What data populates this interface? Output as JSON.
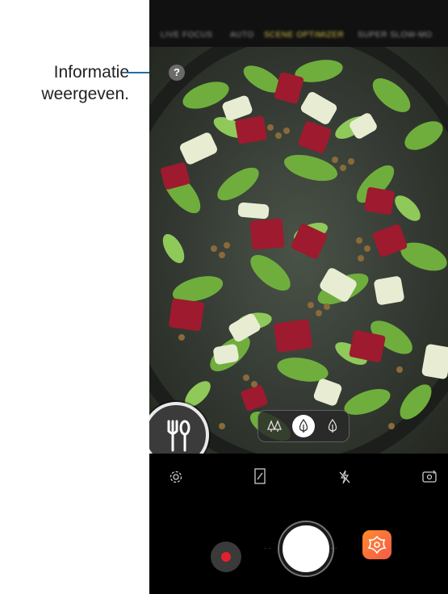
{
  "annotation": {
    "line1": "Informatie",
    "line2": "weergeven."
  },
  "camera_modes": [
    {
      "label": "LIVE FOCUS",
      "active": false
    },
    {
      "label": "AUTO",
      "active": false
    },
    {
      "label": "SCENE OPTIMIZER",
      "active": true
    },
    {
      "label": "SUPER SLOW-MO",
      "active": false
    }
  ],
  "info_button": {
    "label": "?"
  },
  "scene": {
    "name": "food-icon"
  },
  "filter_options": [
    "blur-low-icon",
    "blur-medium-icon",
    "blur-high-icon"
  ],
  "controls": {
    "settings": "gear-icon",
    "ratio": "aspect-ratio-icon",
    "flash": "flash-off-icon",
    "switch": "switch-camera-icon",
    "record": "record-icon",
    "shutter": "shutter-icon",
    "gallery": "bixby-vision-icon"
  },
  "colors": {
    "accent_line": "#1f6fa8",
    "record_red": "#e3202d",
    "active_mode": "#d8c84a"
  }
}
